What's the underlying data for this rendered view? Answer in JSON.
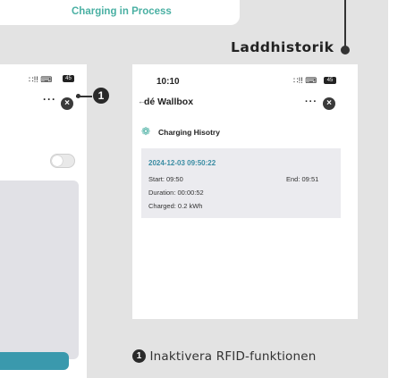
{
  "top_card": {
    "label": "Charging in Process"
  },
  "callout": {
    "title": "Laddhistorik"
  },
  "left_phone": {
    "status_icons": "∷!! ⌨",
    "battery": "45",
    "menu": "···",
    "close_glyph": "×",
    "toggle_on": false
  },
  "marker": {
    "number": "1"
  },
  "right_phone": {
    "time": "10:10",
    "status_icons": "∷!! ⌨",
    "battery": "45",
    "back_glyph": "←",
    "title": "dé Wallbox",
    "menu": "···",
    "close_glyph": "×",
    "history_icon": "❁",
    "history_label": "Charging Hisotry",
    "session": {
      "date": "2024-12-03 09:50:22",
      "start": "Start: 09:50",
      "end": "End: 09:51",
      "duration": "Duration: 00:00:52",
      "charged": "Charged: 0.2 kWh"
    }
  },
  "caption": {
    "marker": "1",
    "text": "Inaktivera RFID-funktionen"
  }
}
